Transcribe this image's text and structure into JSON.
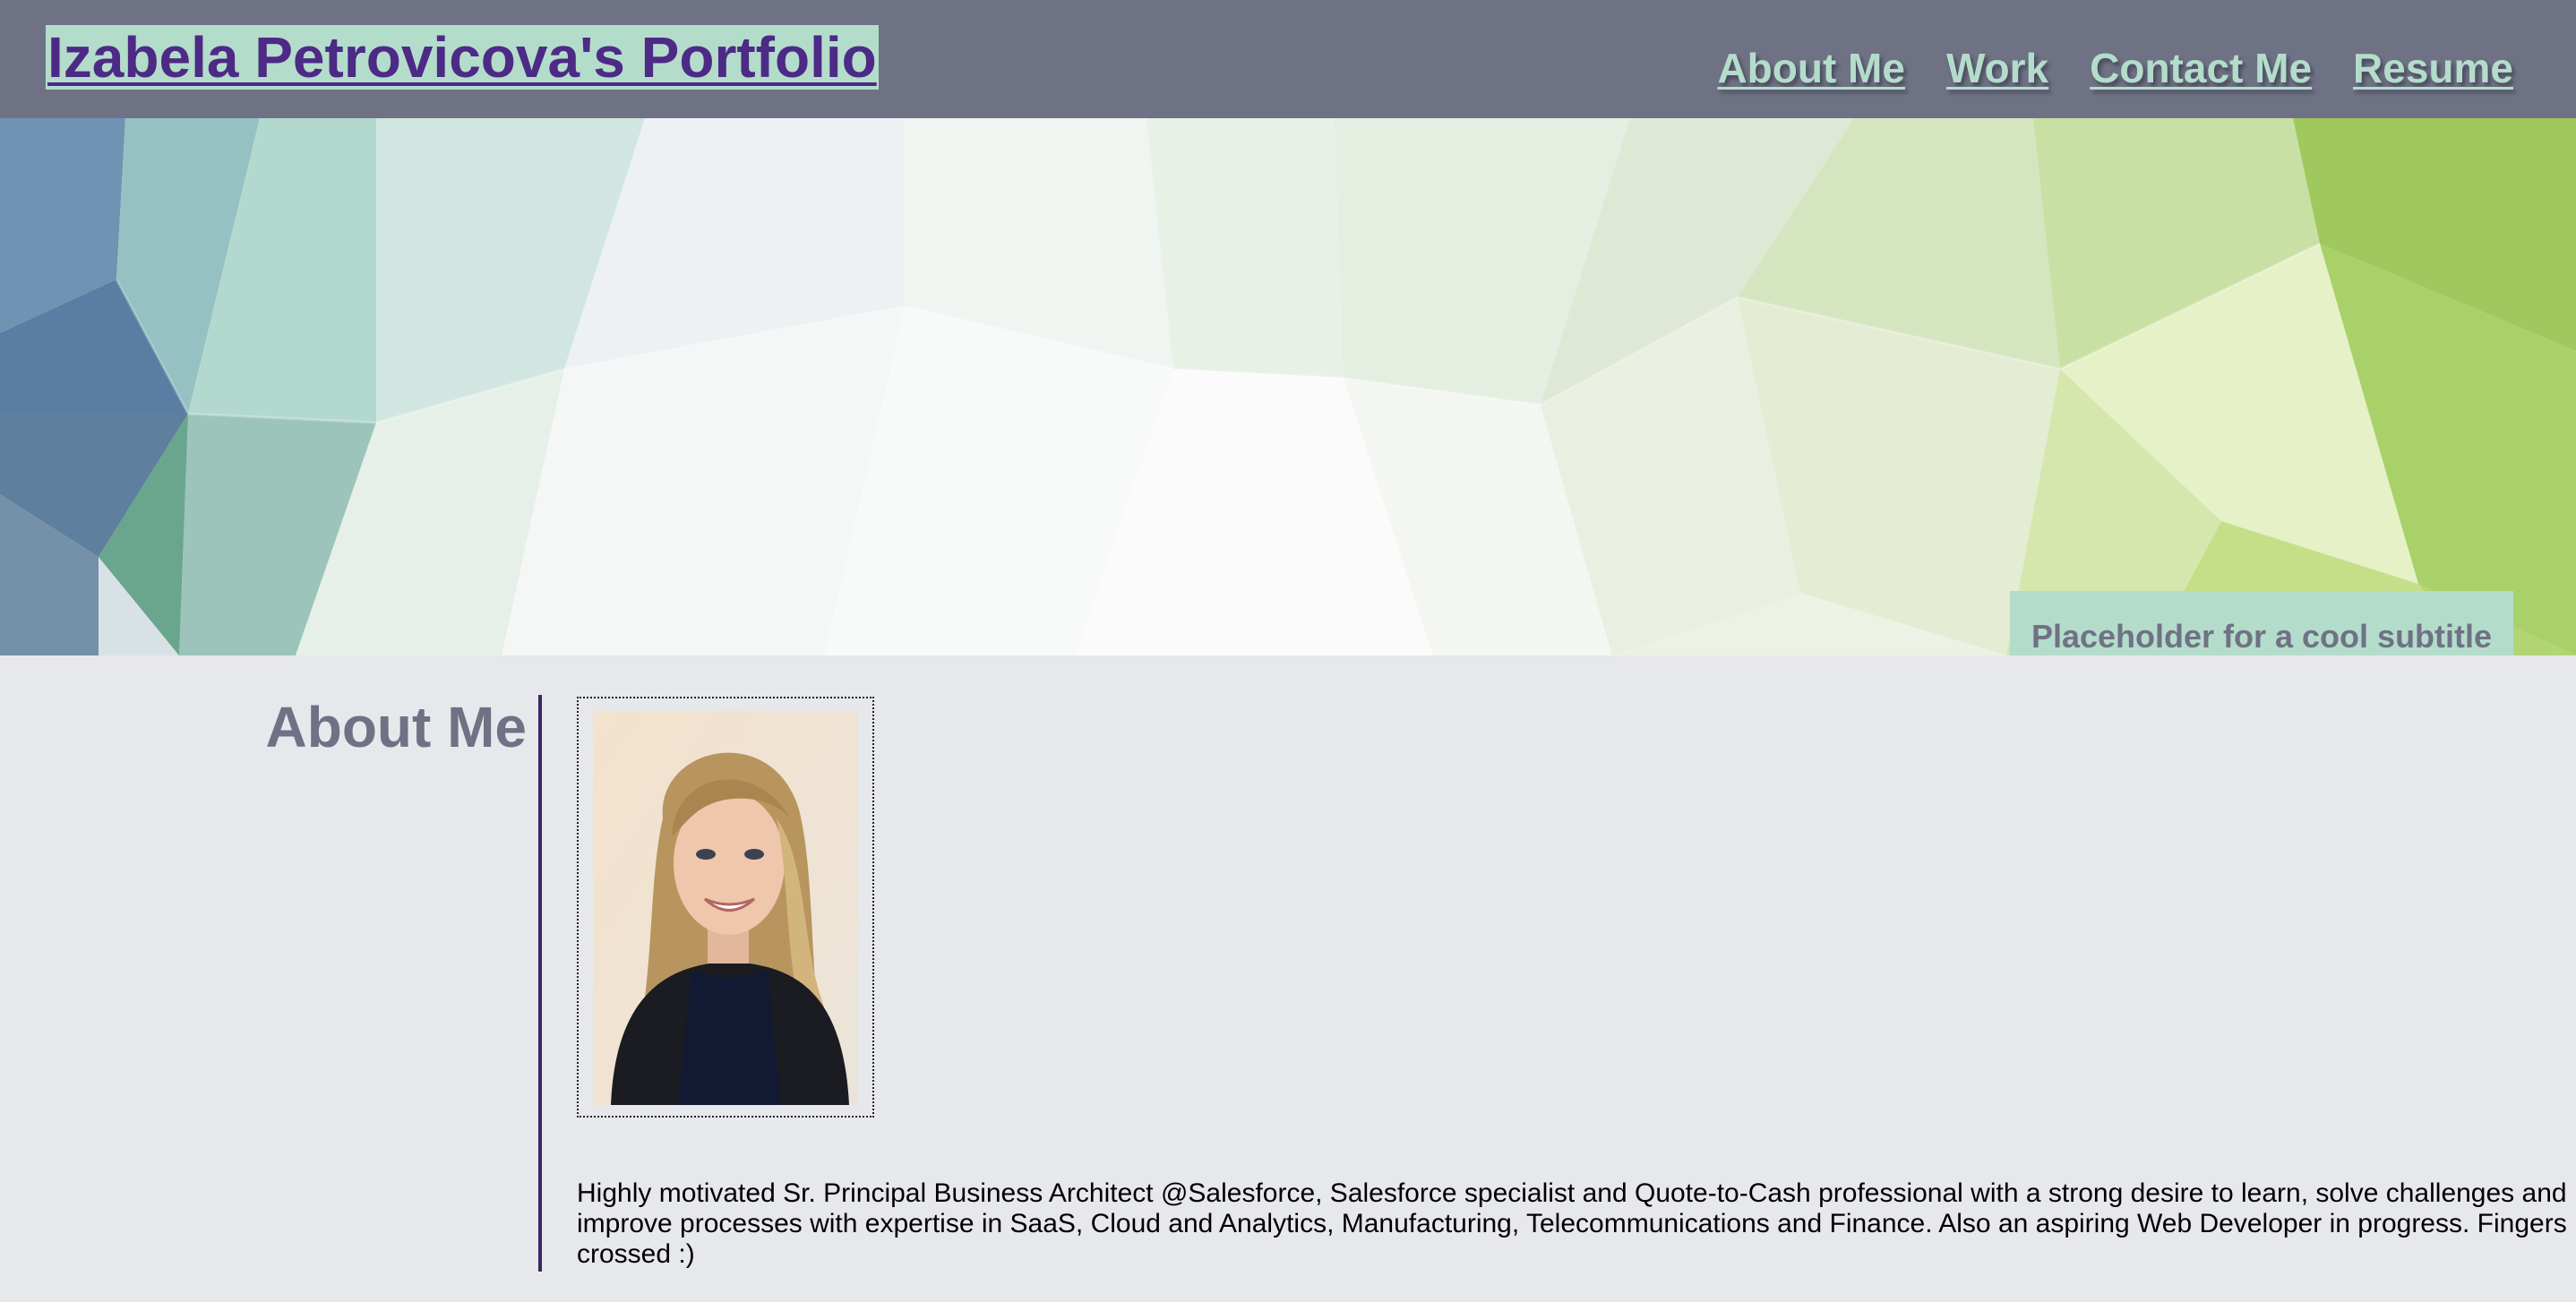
{
  "header": {
    "site_title": "Izabela Petrovicova's Portfolio",
    "nav": [
      {
        "label": "About Me"
      },
      {
        "label": "Work"
      },
      {
        "label": "Contact Me"
      },
      {
        "label": "Resume"
      }
    ]
  },
  "hero": {
    "subtitle": "Placeholder for a cool subtitle"
  },
  "about": {
    "heading": "About Me",
    "bio": "Highly motivated Sr. Principal Business Architect @Salesforce, Salesforce specialist and Quote-to-Cash professional with a strong desire to learn, solve challenges and improve processes with expertise in SaaS, Cloud and Analytics, Manufacturing, Telecommunications and Finance. Also an aspiring Web Developer in progress. Fingers crossed :)"
  },
  "colors": {
    "header_bg": "#6f7284",
    "accent_mint": "#b4dccb",
    "title_purple": "#4c2a86",
    "page_bg": "#e7e8ec",
    "divider": "#3b2663"
  }
}
